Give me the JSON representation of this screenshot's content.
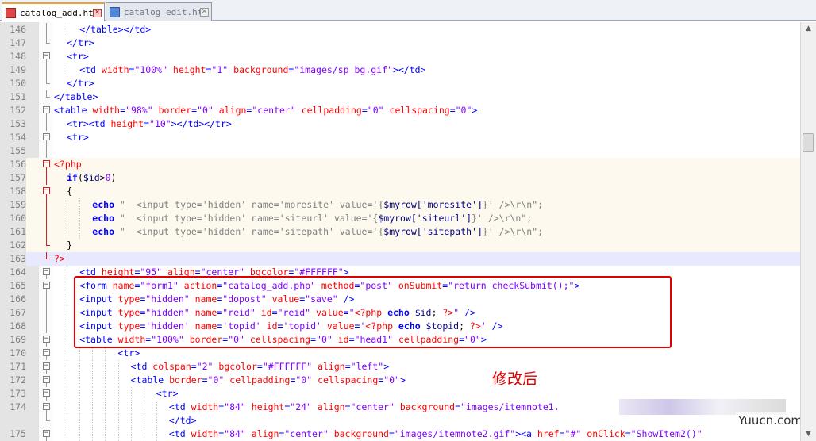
{
  "tabs": [
    {
      "label": "catalog_add.htm",
      "active": true
    },
    {
      "label": "catalog_edit.htm",
      "active": false
    }
  ],
  "annotation": "修改后",
  "watermark": "Yuucn.com",
  "lines": [
    {
      "num": "146",
      "fold": "line",
      "indent": 2,
      "style": "",
      "tokens": [
        [
          "tag",
          "</table></td>"
        ]
      ]
    },
    {
      "num": "147",
      "fold": "end",
      "indent": 1,
      "style": "",
      "tokens": [
        [
          "tag",
          "</tr>"
        ]
      ]
    },
    {
      "num": "148",
      "fold": "open",
      "indent": 1,
      "style": "",
      "tokens": [
        [
          "tag",
          "<tr>"
        ]
      ]
    },
    {
      "num": "149",
      "fold": "line",
      "indent": 2,
      "style": "",
      "tokens": [
        [
          "tag",
          "<td "
        ],
        [
          "attr",
          "width"
        ],
        [
          "tag",
          "="
        ],
        [
          "str",
          "\"100%\""
        ],
        [
          "tag",
          " "
        ],
        [
          "attr",
          "height"
        ],
        [
          "tag",
          "="
        ],
        [
          "str",
          "\"1\""
        ],
        [
          "tag",
          " "
        ],
        [
          "attr",
          "background"
        ],
        [
          "tag",
          "="
        ],
        [
          "str",
          "\"images/sp_bg.gif\""
        ],
        [
          "tag",
          "></td>"
        ]
      ]
    },
    {
      "num": "150",
      "fold": "end",
      "indent": 1,
      "style": "",
      "tokens": [
        [
          "tag",
          "</tr>"
        ]
      ]
    },
    {
      "num": "151",
      "fold": "end",
      "indent": 0,
      "style": "",
      "tokens": [
        [
          "tag",
          "</table>"
        ]
      ]
    },
    {
      "num": "152",
      "fold": "open",
      "indent": 0,
      "style": "",
      "tokens": [
        [
          "tag",
          "<table "
        ],
        [
          "attr",
          "width"
        ],
        [
          "tag",
          "="
        ],
        [
          "str",
          "\"98%\""
        ],
        [
          "tag",
          " "
        ],
        [
          "attr",
          "border"
        ],
        [
          "tag",
          "="
        ],
        [
          "str",
          "\"0\""
        ],
        [
          "tag",
          " "
        ],
        [
          "attr",
          "align"
        ],
        [
          "tag",
          "="
        ],
        [
          "str",
          "\"center\""
        ],
        [
          "tag",
          " "
        ],
        [
          "attr",
          "cellpadding"
        ],
        [
          "tag",
          "="
        ],
        [
          "str",
          "\"0\""
        ],
        [
          "tag",
          " "
        ],
        [
          "attr",
          "cellspacing"
        ],
        [
          "tag",
          "="
        ],
        [
          "str",
          "\"0\""
        ],
        [
          "tag",
          ">"
        ]
      ]
    },
    {
      "num": "153",
      "fold": "line",
      "indent": 1,
      "style": "",
      "tokens": [
        [
          "tag",
          "<tr><td "
        ],
        [
          "attr",
          "height"
        ],
        [
          "tag",
          "="
        ],
        [
          "str",
          "\"10\""
        ],
        [
          "tag",
          "></td></tr>"
        ]
      ]
    },
    {
      "num": "154",
      "fold": "open",
      "indent": 1,
      "style": "",
      "tokens": [
        [
          "tag",
          "<tr>"
        ]
      ]
    },
    {
      "num": "155",
      "fold": "line",
      "indent": 0,
      "style": "",
      "tokens": [
        [
          "def",
          ""
        ]
      ]
    },
    {
      "num": "156",
      "fold": "open-red",
      "indent": 0,
      "style": "php",
      "tokens": [
        [
          "php",
          "<?php"
        ]
      ]
    },
    {
      "num": "157",
      "fold": "line-red",
      "indent": 1,
      "style": "php",
      "tokens": [
        [
          "kw",
          "if"
        ],
        [
          "def",
          "("
        ],
        [
          "var",
          "$id"
        ],
        [
          "def",
          ">"
        ],
        [
          "br",
          "0"
        ],
        [
          "def",
          ")"
        ]
      ]
    },
    {
      "num": "158",
      "fold": "open-red",
      "indent": 1,
      "style": "php",
      "tokens": [
        [
          "def",
          "{"
        ]
      ]
    },
    {
      "num": "159",
      "fold": "line-red",
      "indent": 3,
      "style": "php",
      "tokens": [
        [
          "kw",
          "echo"
        ],
        [
          "phpstr",
          " \"  <input type='hidden' name='moresite' value='{"
        ],
        [
          "var",
          "$myrow['moresite']"
        ],
        [
          "phpstr",
          "}' />\\r\\n\";"
        ]
      ]
    },
    {
      "num": "160",
      "fold": "line-red",
      "indent": 3,
      "style": "php",
      "tokens": [
        [
          "kw",
          "echo"
        ],
        [
          "phpstr",
          " \"  <input type='hidden' name='siteurl' value='{"
        ],
        [
          "var",
          "$myrow['siteurl']"
        ],
        [
          "phpstr",
          "}' />\\r\\n\";"
        ]
      ]
    },
    {
      "num": "161",
      "fold": "line-red",
      "indent": 3,
      "style": "php",
      "tokens": [
        [
          "kw",
          "echo"
        ],
        [
          "phpstr",
          " \"  <input type='hidden' name='sitepath' value='{"
        ],
        [
          "var",
          "$myrow['sitepath']"
        ],
        [
          "phpstr",
          "}' />\\r\\n\";"
        ]
      ]
    },
    {
      "num": "162",
      "fold": "end-red",
      "indent": 1,
      "style": "php",
      "tokens": [
        [
          "def",
          "}"
        ]
      ]
    },
    {
      "num": "163",
      "fold": "end-red",
      "indent": 0,
      "style": "cur",
      "tokens": [
        [
          "php",
          "?>"
        ]
      ]
    },
    {
      "num": "164",
      "fold": "open",
      "indent": 2,
      "style": "",
      "tokens": [
        [
          "tag",
          "<td "
        ],
        [
          "attr",
          "height"
        ],
        [
          "tag",
          "="
        ],
        [
          "str",
          "\"95\""
        ],
        [
          "tag",
          " "
        ],
        [
          "attr",
          "align"
        ],
        [
          "tag",
          "="
        ],
        [
          "str",
          "\"center\""
        ],
        [
          "tag",
          " "
        ],
        [
          "attr",
          "bgcolor"
        ],
        [
          "tag",
          "="
        ],
        [
          "str",
          "\"#FFFFFF\""
        ],
        [
          "tag",
          ">"
        ]
      ]
    },
    {
      "num": "165",
      "fold": "open",
      "indent": 2,
      "style": "",
      "tokens": [
        [
          "tag",
          "<form "
        ],
        [
          "attr",
          "name"
        ],
        [
          "tag",
          "="
        ],
        [
          "str",
          "\"form1\""
        ],
        [
          "tag",
          " "
        ],
        [
          "attr",
          "action"
        ],
        [
          "tag",
          "="
        ],
        [
          "str",
          "\"catalog_add.php\""
        ],
        [
          "tag",
          " "
        ],
        [
          "attr",
          "method"
        ],
        [
          "tag",
          "="
        ],
        [
          "str",
          "\"post\""
        ],
        [
          "tag",
          " "
        ],
        [
          "attr",
          "onSubmit"
        ],
        [
          "tag",
          "="
        ],
        [
          "str",
          "\"return checkSubmit();\""
        ],
        [
          "tag",
          ">"
        ]
      ]
    },
    {
      "num": "166",
      "fold": "line",
      "indent": 2,
      "style": "",
      "tokens": [
        [
          "tag",
          "<input "
        ],
        [
          "attr",
          "type"
        ],
        [
          "tag",
          "="
        ],
        [
          "str",
          "\"hidden\""
        ],
        [
          "tag",
          " "
        ],
        [
          "attr",
          "name"
        ],
        [
          "tag",
          "="
        ],
        [
          "str",
          "\"dopost\""
        ],
        [
          "tag",
          " "
        ],
        [
          "attr",
          "value"
        ],
        [
          "tag",
          "="
        ],
        [
          "str",
          "\"save\""
        ],
        [
          "tag",
          " />"
        ]
      ]
    },
    {
      "num": "167",
      "fold": "line",
      "indent": 2,
      "style": "",
      "tokens": [
        [
          "tag",
          "<input "
        ],
        [
          "attr",
          "type"
        ],
        [
          "tag",
          "="
        ],
        [
          "str",
          "\"hidden\""
        ],
        [
          "tag",
          " "
        ],
        [
          "attr",
          "name"
        ],
        [
          "tag",
          "="
        ],
        [
          "str",
          "\"reid\""
        ],
        [
          "tag",
          " "
        ],
        [
          "attr",
          "id"
        ],
        [
          "tag",
          "="
        ],
        [
          "str",
          "\"reid\""
        ],
        [
          "tag",
          " "
        ],
        [
          "attr",
          "value"
        ],
        [
          "tag",
          "="
        ],
        [
          "str",
          "\""
        ],
        [
          "php",
          "<?php"
        ],
        [
          "kw",
          " echo "
        ],
        [
          "var",
          "$id"
        ],
        [
          "def",
          "; "
        ],
        [
          "php",
          "?>"
        ],
        [
          "str",
          "\""
        ],
        [
          "tag",
          " />"
        ]
      ]
    },
    {
      "num": "168",
      "fold": "line",
      "indent": 2,
      "style": "",
      "tokens": [
        [
          "tag",
          "<input "
        ],
        [
          "attr",
          "type"
        ],
        [
          "tag",
          "="
        ],
        [
          "str",
          "'hidden'"
        ],
        [
          "tag",
          " "
        ],
        [
          "attr",
          "name"
        ],
        [
          "tag",
          "="
        ],
        [
          "str",
          "'topid'"
        ],
        [
          "tag",
          " "
        ],
        [
          "attr",
          "id"
        ],
        [
          "tag",
          "="
        ],
        [
          "str",
          "'topid'"
        ],
        [
          "tag",
          " "
        ],
        [
          "attr",
          "value"
        ],
        [
          "tag",
          "="
        ],
        [
          "str",
          "'"
        ],
        [
          "php",
          "<?php"
        ],
        [
          "kw",
          " echo "
        ],
        [
          "var",
          "$topid"
        ],
        [
          "def",
          "; "
        ],
        [
          "php",
          "?>"
        ],
        [
          "str",
          "'"
        ],
        [
          "tag",
          " />"
        ]
      ]
    },
    {
      "num": "169",
      "fold": "open",
      "indent": 2,
      "style": "",
      "tokens": [
        [
          "tag",
          "<table "
        ],
        [
          "attr",
          "width"
        ],
        [
          "tag",
          "="
        ],
        [
          "str",
          "\"100%\""
        ],
        [
          "tag",
          " "
        ],
        [
          "attr",
          "border"
        ],
        [
          "tag",
          "="
        ],
        [
          "str",
          "\"0\""
        ],
        [
          "tag",
          " "
        ],
        [
          "attr",
          "cellspacing"
        ],
        [
          "tag",
          "="
        ],
        [
          "str",
          "\"0\""
        ],
        [
          "tag",
          " "
        ],
        [
          "attr",
          "id"
        ],
        [
          "tag",
          "="
        ],
        [
          "str",
          "\"head1\""
        ],
        [
          "tag",
          " "
        ],
        [
          "attr",
          "cellpadding"
        ],
        [
          "tag",
          "="
        ],
        [
          "str",
          "\"0\""
        ],
        [
          "tag",
          ">"
        ]
      ]
    },
    {
      "num": "170",
      "fold": "open",
      "indent": 5,
      "style": "",
      "tokens": [
        [
          "tag",
          "<tr>"
        ]
      ]
    },
    {
      "num": "171",
      "fold": "open",
      "indent": 6,
      "style": "",
      "tokens": [
        [
          "tag",
          "<td "
        ],
        [
          "attr",
          "colspan"
        ],
        [
          "tag",
          "="
        ],
        [
          "str",
          "\"2\""
        ],
        [
          "tag",
          " "
        ],
        [
          "attr",
          "bgcolor"
        ],
        [
          "tag",
          "="
        ],
        [
          "str",
          "\"#FFFFFF\""
        ],
        [
          "tag",
          " "
        ],
        [
          "attr",
          "align"
        ],
        [
          "tag",
          "="
        ],
        [
          "str",
          "\"left\""
        ],
        [
          "tag",
          ">"
        ]
      ]
    },
    {
      "num": "172",
      "fold": "open",
      "indent": 6,
      "style": "",
      "tokens": [
        [
          "tag",
          "<table "
        ],
        [
          "attr",
          "border"
        ],
        [
          "tag",
          "="
        ],
        [
          "str",
          "\"0\""
        ],
        [
          "tag",
          " "
        ],
        [
          "attr",
          "cellpadding"
        ],
        [
          "tag",
          "="
        ],
        [
          "str",
          "\"0\""
        ],
        [
          "tag",
          " "
        ],
        [
          "attr",
          "cellspacing"
        ],
        [
          "tag",
          "="
        ],
        [
          "str",
          "\"0\""
        ],
        [
          "tag",
          ">"
        ]
      ]
    },
    {
      "num": "173",
      "fold": "open",
      "indent": 8,
      "style": "",
      "tokens": [
        [
          "tag",
          "<tr>"
        ]
      ]
    },
    {
      "num": "174",
      "fold": "open",
      "indent": 9,
      "style": "",
      "tokens": [
        [
          "tag",
          "<td "
        ],
        [
          "attr",
          "width"
        ],
        [
          "tag",
          "="
        ],
        [
          "str",
          "\"84\""
        ],
        [
          "tag",
          " "
        ],
        [
          "attr",
          "height"
        ],
        [
          "tag",
          "="
        ],
        [
          "str",
          "\"24\""
        ],
        [
          "tag",
          " "
        ],
        [
          "attr",
          "align"
        ],
        [
          "tag",
          "="
        ],
        [
          "str",
          "\"center\""
        ],
        [
          "tag",
          " "
        ],
        [
          "attr",
          "background"
        ],
        [
          "tag",
          "="
        ],
        [
          "str",
          "\"images/itemnote1."
        ]
      ]
    },
    {
      "num": "",
      "fold": "end",
      "indent": 9,
      "style": "",
      "tokens": [
        [
          "tag",
          "</td>"
        ]
      ]
    },
    {
      "num": "175",
      "fold": "open",
      "indent": 9,
      "style": "",
      "tokens": [
        [
          "tag",
          "<td "
        ],
        [
          "attr",
          "width"
        ],
        [
          "tag",
          "="
        ],
        [
          "str",
          "\"84\""
        ],
        [
          "tag",
          " "
        ],
        [
          "attr",
          "align"
        ],
        [
          "tag",
          "="
        ],
        [
          "str",
          "\"center\""
        ],
        [
          "tag",
          " "
        ],
        [
          "attr",
          "background"
        ],
        [
          "tag",
          "="
        ],
        [
          "str",
          "\"images/itemnote2.gif\""
        ],
        [
          "tag",
          "><a "
        ],
        [
          "attr",
          "href"
        ],
        [
          "tag",
          "="
        ],
        [
          "str",
          "\"#\""
        ],
        [
          "tag",
          " "
        ],
        [
          "attr",
          "onClick"
        ],
        [
          "tag",
          "="
        ],
        [
          "str",
          "\"ShowItem2()\""
        ]
      ]
    }
  ]
}
